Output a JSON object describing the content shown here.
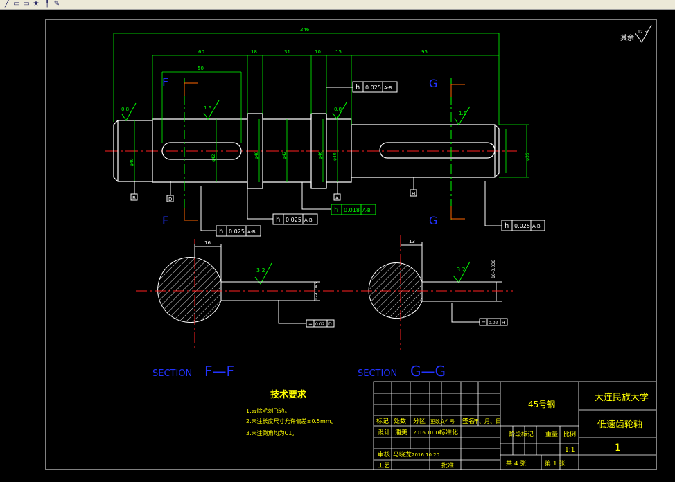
{
  "toolbar": {
    "buttons": [
      {
        "name": "line-tool-icon",
        "glyph": "╱"
      },
      {
        "name": "rectangle-tool-icon",
        "glyph": "▭"
      },
      {
        "name": "save-tool-icon",
        "glyph": "▭"
      },
      {
        "name": "star-tool-icon",
        "glyph": "★"
      },
      {
        "name": "pin-tool-icon",
        "glyph": "╿"
      },
      {
        "name": "paint-tool-icon",
        "glyph": "✎"
      }
    ]
  },
  "colors": {
    "background": "#000000",
    "geometry": "#ffffff",
    "dimension": "#00ff00",
    "centerline": "#ff0000",
    "section_label": "#2233ff",
    "cut_mark": "#ff6600",
    "text": "#ffff00"
  },
  "roughness": {
    "remaining": "其余",
    "remaining_value": "12.5",
    "values": [
      "0.8",
      "1.6",
      "0.8",
      "1.6",
      "3.2",
      "3.2"
    ]
  },
  "dimensions": {
    "overall": "246",
    "segments_top": [
      "60",
      "18",
      "31",
      "10",
      "15",
      "95"
    ],
    "keyway_length_left": "50",
    "keyway_depth_f": "16",
    "keyway_depth_g": "13",
    "keyway_width_f": "12-0.043",
    "keyway_width_g": "10-0.036",
    "diameters": [
      "φ40",
      "φ42",
      "φ48",
      "φ42",
      "φ46",
      "φ40",
      "φ35"
    ]
  },
  "section_marks": {
    "f": "F",
    "g": "G"
  },
  "tolerance_frames": [
    {
      "symbol": "h",
      "value": "0.025",
      "datum": "A-B"
    },
    {
      "symbol": "h",
      "value": "0.025",
      "datum": "A-B"
    },
    {
      "symbol": "h",
      "value": "0.018",
      "datum": "A-B"
    },
    {
      "symbol": "h",
      "value": "0.025",
      "datum": "A-B"
    },
    {
      "symbol": "h",
      "value": "0.025",
      "datum": "A-B"
    }
  ],
  "symmetry_frames": [
    {
      "symbol": "=",
      "value": "0.02",
      "datum": "D"
    },
    {
      "symbol": "=",
      "value": "0.02",
      "datum": "H"
    }
  ],
  "datum_labels": [
    "B",
    "D",
    "A",
    "H"
  ],
  "sections": {
    "left_title": "SECTION",
    "left_name": "F—F",
    "right_title": "SECTION",
    "right_name": "G—G"
  },
  "technical_requirements": {
    "heading": "技术要求",
    "items": [
      "1.去除毛刺飞边。",
      "2.未注长度尺寸允许偏差±0.5mm。",
      "3.未注倒角均为C1。"
    ]
  },
  "title_block": {
    "material": "45号钢",
    "school": "大连民族大学",
    "part_name": "低速齿轮轴",
    "drawing_no": "1",
    "scale_label": "比例",
    "scale_value": "1:1",
    "weight_label": "重量",
    "stage_label": "阶段标记",
    "sheets": "共  4  张",
    "sheet_no": "第  1  张",
    "rev_headers": [
      "标记",
      "处数",
      "分区",
      "更改文件号",
      "签名",
      "年、月、日"
    ],
    "design_label": "设计",
    "designer": "潘美",
    "design_date": "2016.10.16",
    "standard_label": "标准化",
    "review_label": "审核",
    "reviewer": "马晓龙",
    "review_date": "2016.10.20",
    "process_label": "工艺",
    "approve_label": "批准"
  }
}
